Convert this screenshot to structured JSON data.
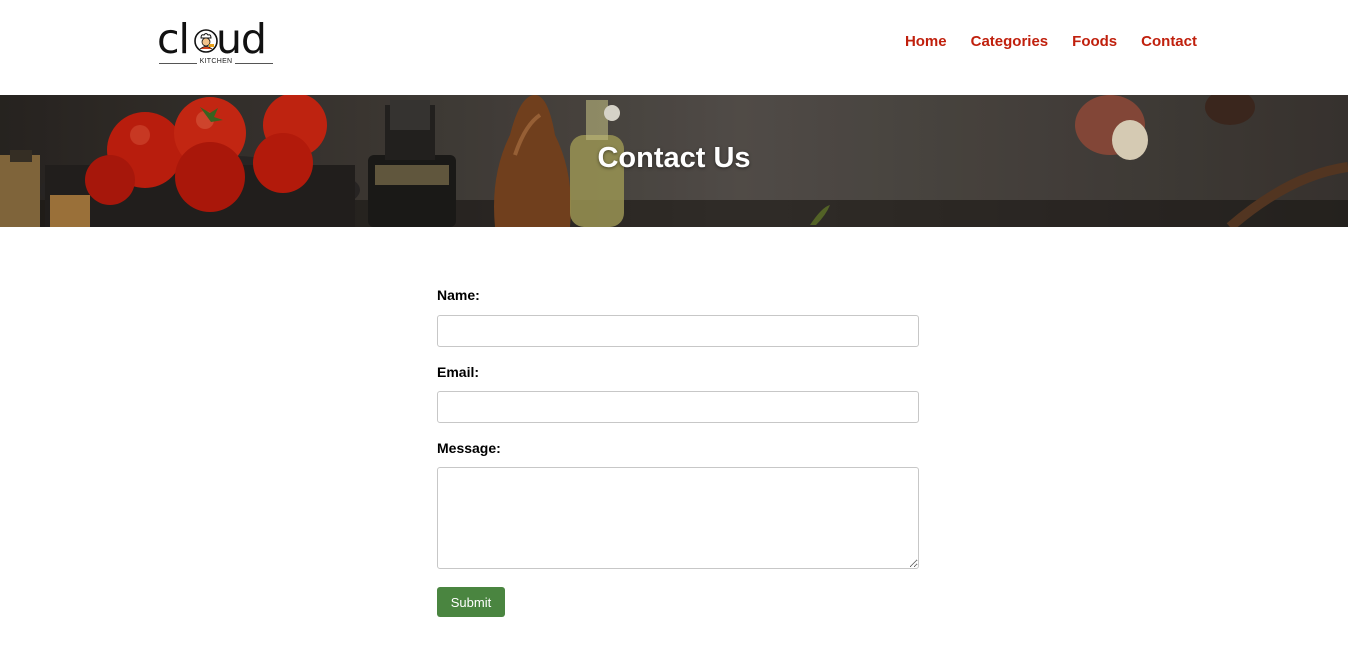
{
  "brand": {
    "logo_word_left": "cl",
    "logo_word_right": "ud",
    "logo_subtitle": "KITCHEN"
  },
  "nav": {
    "items": [
      "Home",
      "Categories",
      "Foods",
      "Contact"
    ],
    "color": "#c0200d"
  },
  "banner": {
    "title": "Contact Us"
  },
  "form": {
    "name_label": "Name:",
    "name_value": "",
    "email_label": "Email:",
    "email_value": "",
    "message_label": "Message:",
    "message_value": "",
    "submit_label": "Submit",
    "submit_color": "#4a8540"
  },
  "icons": {
    "logo_mascot": "chef-icon",
    "textarea_corner": "resize-handle-icon"
  }
}
